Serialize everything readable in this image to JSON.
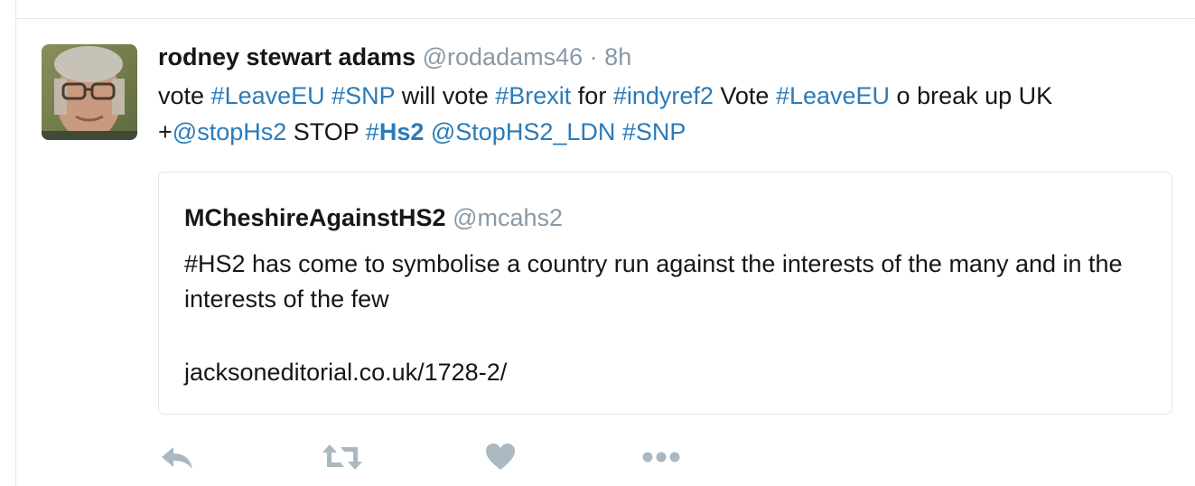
{
  "tweet": {
    "display_name": "rodney stewart adams",
    "handle": "@rodadams46",
    "separator": "·",
    "time": "8h",
    "text_parts": [
      {
        "text": "vote ",
        "type": "plain"
      },
      {
        "text": "#LeaveEU",
        "type": "tag"
      },
      {
        "text": " ",
        "type": "plain"
      },
      {
        "text": "#SNP",
        "type": "tag"
      },
      {
        "text": " will vote ",
        "type": "plain"
      },
      {
        "text": "#Brexit",
        "type": "tag"
      },
      {
        "text": " for ",
        "type": "plain"
      },
      {
        "text": "#indyref2",
        "type": "tag"
      },
      {
        "text": " Vote ",
        "type": "plain"
      },
      {
        "text": "#LeaveEU",
        "type": "tag"
      },
      {
        "text": " o break up UK +",
        "type": "plain"
      },
      {
        "text": "@stopHs2",
        "type": "tag"
      },
      {
        "text": " STOP ",
        "type": "plain"
      },
      {
        "text": "#",
        "type": "tag"
      },
      {
        "text": "Hs2",
        "type": "tag-bold"
      },
      {
        "text": " ",
        "type": "plain"
      },
      {
        "text": "@StopHS2_LDN",
        "type": "tag"
      },
      {
        "text": " ",
        "type": "plain"
      },
      {
        "text": "#SNP",
        "type": "tag"
      }
    ]
  },
  "quoted": {
    "display_name": "MCheshireAgainstHS2",
    "handle": "@mcahs2",
    "text": "#HS2 has come to symbolise a country run against the interests of the many and in the interests of the few",
    "link": "jacksoneditorial.co.uk/1728-2/"
  },
  "actions": [
    {
      "name": "reply",
      "icon": "reply-icon"
    },
    {
      "name": "retweet",
      "icon": "retweet-icon"
    },
    {
      "name": "like",
      "icon": "heart-icon"
    },
    {
      "name": "more",
      "icon": "more-icon"
    }
  ],
  "colors": {
    "link": "#2b7bb9",
    "muted": "#8899a6",
    "icon": "#aab8c2",
    "border": "#e1e8ed",
    "text": "#14171a"
  }
}
